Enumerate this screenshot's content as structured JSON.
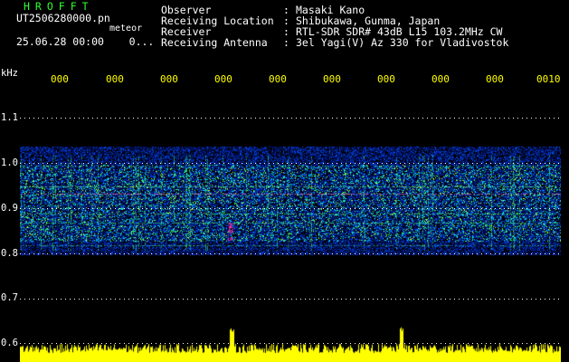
{
  "header": {
    "brand": "HROFFT",
    "filename": "UT2506280000.pn",
    "tag": "meteor",
    "datetime": "25.06.28 00:00",
    "datetime_suffix": "0..."
  },
  "info": [
    {
      "key": "Observer",
      "value": "Masaki Kano"
    },
    {
      "key": "Receiving Location",
      "value": "Shibukawa, Gunma, Japan"
    },
    {
      "key": "Receiver",
      "value": "RTL-SDR SDR# 43dB L15 103.2MHz CW"
    },
    {
      "key": "Receiving Antenna",
      "value": "3el Yagi(V) Az 330 for Vladivostok"
    }
  ],
  "axis": {
    "unit": "kHz",
    "y_ticks": [
      "1.1",
      "1.0",
      "0.9",
      "0.8",
      "0.7",
      "0.6"
    ],
    "x_ticks": [
      "000",
      "000",
      "000",
      "000",
      "000",
      "000",
      "000",
      "000",
      "000",
      "0010"
    ]
  },
  "colors": {
    "accent_green": "#2aff2a",
    "tick_yellow": "#ffff00",
    "amplitude_yellow": "#ffff00"
  }
}
